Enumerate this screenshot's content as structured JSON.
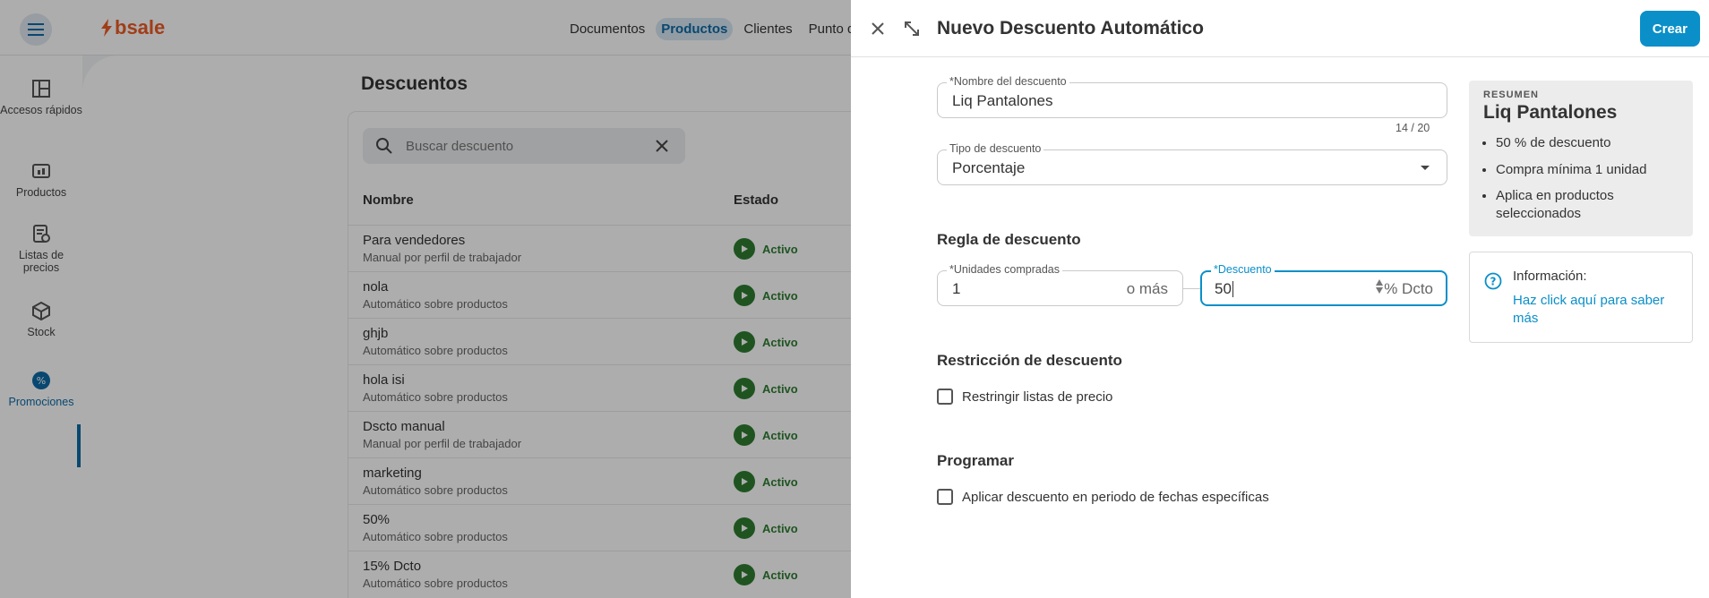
{
  "topbar": {
    "logo_text": "bsale",
    "nav": [
      "Documentos",
      "Productos",
      "Clientes",
      "Punto de"
    ],
    "active_nav": "Productos"
  },
  "sidebar": {
    "items": [
      {
        "label": "Accesos rápidos",
        "icon": "quick-access-icon"
      },
      {
        "label": "Productos",
        "icon": "products-icon"
      },
      {
        "label": "Listas de precios",
        "icon": "price-list-icon"
      },
      {
        "label": "Stock",
        "icon": "stock-box-icon"
      },
      {
        "label": "Promociones",
        "icon": "promotions-icon"
      }
    ],
    "active": "Promociones"
  },
  "page": {
    "title": "Descuentos",
    "search_placeholder": "Buscar descuento",
    "columns": [
      "Nombre",
      "Estado"
    ],
    "rows": [
      {
        "name": "Para vendedores",
        "sub": "Manual por perfil de trabajador",
        "status": "Activo"
      },
      {
        "name": "nola",
        "sub": "Automático sobre productos",
        "status": "Activo"
      },
      {
        "name": "ghjb",
        "sub": "Automático sobre productos",
        "status": "Activo"
      },
      {
        "name": "hola isi",
        "sub": "Automático sobre productos",
        "status": "Activo"
      },
      {
        "name": "Dscto manual",
        "sub": "Manual por perfil de trabajador",
        "status": "Activo"
      },
      {
        "name": "marketing",
        "sub": "Automático sobre productos",
        "status": "Activo"
      },
      {
        "name": "50%",
        "sub": "Automático sobre productos",
        "status": "Activo"
      },
      {
        "name": "15% Dcto",
        "sub": "Automático sobre productos",
        "status": "Activo"
      }
    ]
  },
  "drawer": {
    "title": "Nuevo Descuento Automático",
    "create_label": "Crear",
    "name_field": {
      "label": "*Nombre del descuento",
      "value": "Liq Pantalones",
      "counter": "14 / 20"
    },
    "type_field": {
      "label": "Tipo de descuento",
      "value": "Porcentaje"
    },
    "rule_section": "Regla de descuento",
    "units_field": {
      "label": "*Unidades compradas",
      "value": "1",
      "suffix": "o más"
    },
    "discount_field": {
      "label": "*Descuento",
      "value": "50",
      "suffix": "% Dcto"
    },
    "restriction_section": "Restricción de descuento",
    "restriction_checkbox": "Restringir listas de precio",
    "schedule_section": "Programar",
    "schedule_checkbox": "Aplicar descuento en periodo de fechas específicas",
    "summary": {
      "kicker": "RESUMEN",
      "title": "Liq Pantalones",
      "items": [
        "50 % de descuento",
        "Compra mínima 1 unidad",
        "Aplica en productos seleccionados"
      ]
    },
    "info": {
      "title": "Información:",
      "link": "Haz click aquí para saber más"
    }
  },
  "colors": {
    "accent": "#0a8fc9",
    "brand": "#ee5a24",
    "active_status": "#2e7d32"
  }
}
